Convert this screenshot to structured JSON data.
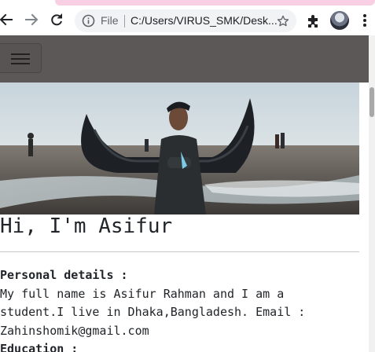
{
  "browser": {
    "url_scheme": "File",
    "url": "C:/Users/VIRUS_SMK/Desk...",
    "icons": {
      "back": "back-arrow-icon",
      "forward": "forward-arrow-icon",
      "reload": "reload-icon",
      "info": "info-icon",
      "bookmark": "star-icon",
      "extensions": "puzzle-icon",
      "profile": "avatar",
      "menu": "kebab-menu-icon"
    }
  },
  "site": {
    "nav_toggle_icon": "hamburger-icon",
    "hero_alt": "Asifur Rahman",
    "title": "Hi, I'm Asifur",
    "sections": {
      "personal": {
        "heading": "Personal details :",
        "lines": [
          "My full name is Asifur Rahman and I am a",
          "student.I live in Dhaka,Bangladesh. Email :",
          "Zahinshomik@gmail.com"
        ]
      },
      "education": {
        "heading": "Education :"
      }
    }
  },
  "colors": {
    "nav_bg": "#5b5857",
    "text": "#212529",
    "omnibox_bg": "#f1f3f4",
    "tab_tint": "#f9d0e3"
  }
}
